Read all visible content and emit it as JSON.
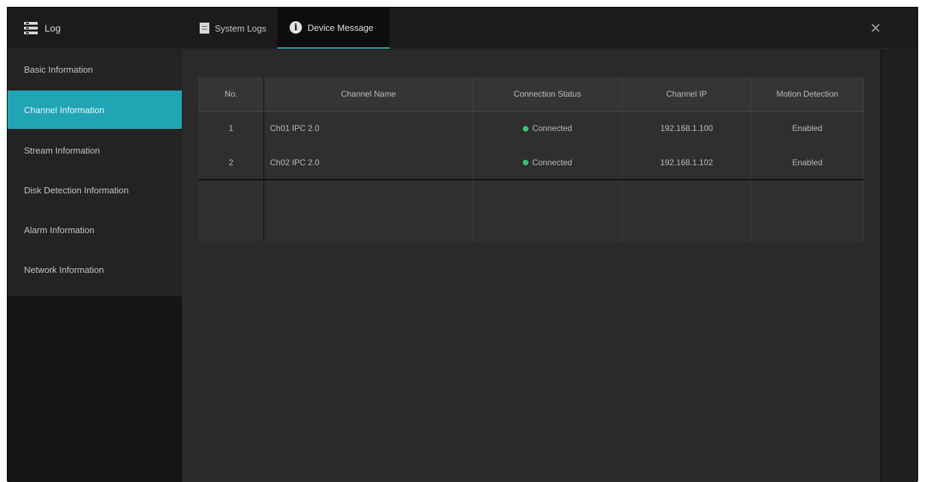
{
  "window": {
    "title": "Log",
    "close_glyph": "✕"
  },
  "tabs": [
    {
      "label": "System Logs",
      "icon": "document-icon",
      "active": false
    },
    {
      "label": "Device Message",
      "icon": "info-icon",
      "active": true
    }
  ],
  "sidebar": {
    "items": [
      {
        "label": "Basic Information",
        "active": false
      },
      {
        "label": "Channel Information",
        "active": true
      },
      {
        "label": "Stream Information",
        "active": false
      },
      {
        "label": "Disk Detection Information",
        "active": false
      },
      {
        "label": "Alarm Information",
        "active": false
      },
      {
        "label": "Network Information",
        "active": false
      }
    ]
  },
  "table": {
    "columns": [
      "No.",
      "Channel Name",
      "Connection Status",
      "Channel IP",
      "Motion Detection"
    ],
    "rows": [
      {
        "no": "1",
        "name": "Ch01 IPC 2.0",
        "status": "Connected",
        "ip": "192.168.1.100",
        "motion": "Enabled"
      },
      {
        "no": "2",
        "name": "Ch02 IPC 2.0",
        "status": "Connected",
        "ip": "192.168.1.102",
        "motion": "Enabled"
      }
    ]
  },
  "colors": {
    "accent": "#21a5b5",
    "status_ok": "#3bc47a"
  }
}
